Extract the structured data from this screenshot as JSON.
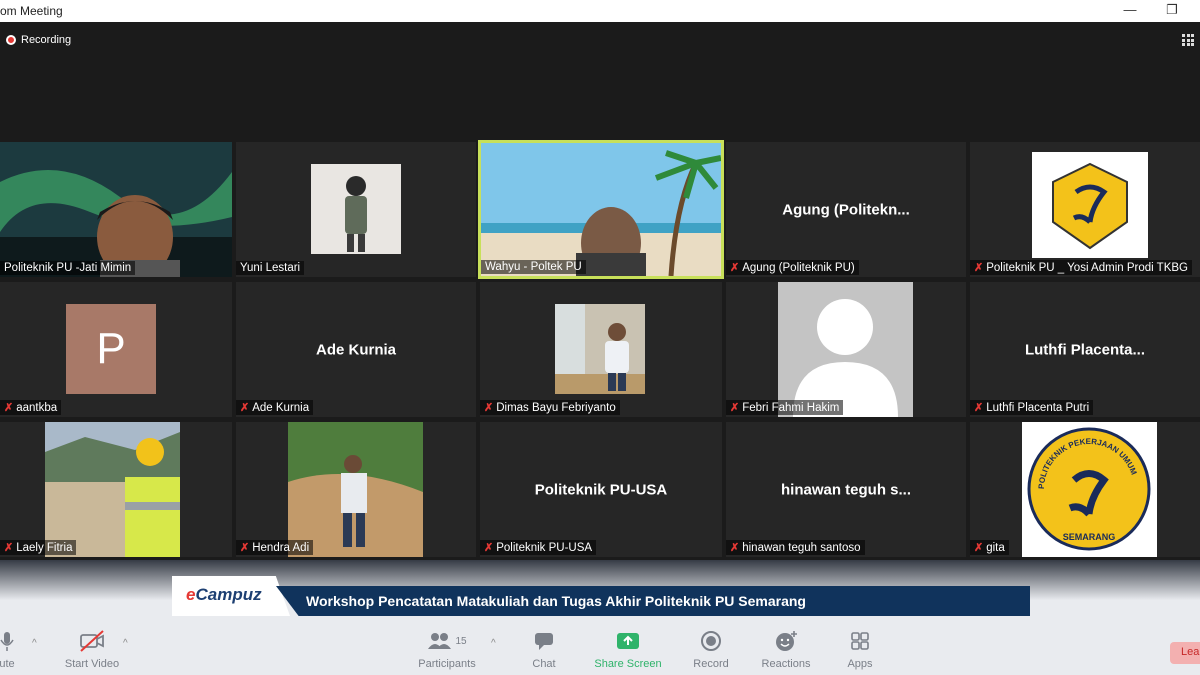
{
  "window": {
    "title": "om Meeting"
  },
  "meeting": {
    "recording_label": "Recording"
  },
  "tiles": [
    {
      "name": "Politeknik PU -Jati Mimin",
      "muted": false
    },
    {
      "name": "Yuni Lestari",
      "muted": false
    },
    {
      "name": "Wahyu - Poltek PU",
      "muted": false,
      "active": true
    },
    {
      "name": "Agung (Politeknik PU)",
      "display": "Agung  (Politekn...",
      "muted": true
    },
    {
      "name": "Politeknik PU _ Yosi Admin Prodi TKBG",
      "muted": true
    },
    {
      "name": "aantkba",
      "avatar_letter": "P",
      "muted": true
    },
    {
      "name": "Ade Kurnia",
      "display": "Ade Kurnia",
      "muted": true
    },
    {
      "name": "Dimas Bayu Febriyanto",
      "muted": true
    },
    {
      "name": "Febri Fahmi Hakim",
      "muted": true
    },
    {
      "name": "Luthfi Placenta Putri",
      "display": "Luthfi  Placenta...",
      "muted": true
    },
    {
      "name": "Laely Fitria",
      "muted": true
    },
    {
      "name": "Hendra Adi",
      "muted": true
    },
    {
      "name": "Politeknik PU-USA",
      "display": "Politeknik PU-USA",
      "muted": true
    },
    {
      "name": "hinawan teguh santoso",
      "display": "hinawan teguh s...",
      "muted": true
    },
    {
      "name": "gita",
      "muted": true
    }
  ],
  "logo_text": {
    "top": "POLITEKNIK PEKERJAAN UMUM",
    "bottom": "SEMARANG"
  },
  "banner": {
    "logo_prefix": "e",
    "logo_rest": "Campuz",
    "title": "Workshop Pencatatan Matakuliah dan Tugas Akhir Politeknik PU Semarang"
  },
  "toolbar": {
    "mute": "ute",
    "start_video": "Start Video",
    "participants": "Participants",
    "participants_count": "15",
    "chat": "Chat",
    "share_screen": "Share Screen",
    "record": "Record",
    "reactions": "Reactions",
    "apps": "Apps",
    "leave": "Lea"
  },
  "colors": {
    "active_border": "#c8e05a",
    "banner_blue": "#10335c",
    "share_green": "#2fb36a",
    "muted_red": "#e53935"
  }
}
